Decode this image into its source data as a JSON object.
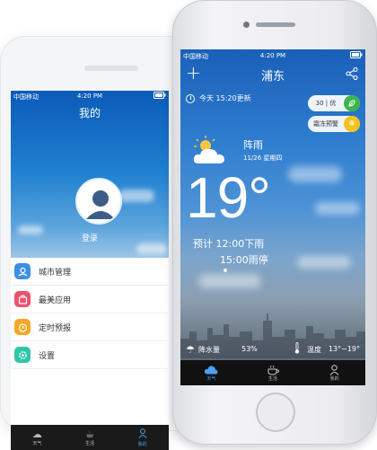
{
  "back_phone": {
    "status": {
      "carrier": "中国移动",
      "time": "4:20 PM"
    },
    "title": "我的",
    "login_label": "登录",
    "menu": [
      {
        "label": "城市管理",
        "icon": "city-icon",
        "color": "#3b8fe5"
      },
      {
        "label": "最美应用",
        "icon": "gift-icon",
        "color": "#f0506e"
      },
      {
        "label": "定时预报",
        "icon": "alarm-icon",
        "color": "#f5a623"
      },
      {
        "label": "设置",
        "icon": "gear-icon",
        "color": "#2fc7a7"
      }
    ],
    "tabs": [
      {
        "label": "天气",
        "icon": "cloud-icon"
      },
      {
        "label": "生活",
        "icon": "coffee-icon"
      },
      {
        "label": "我的",
        "icon": "person-icon"
      }
    ],
    "active_tab": "我的"
  },
  "front_phone": {
    "status": {
      "carrier": "中国移动",
      "time": "4:20 PM"
    },
    "city": "浦东",
    "update_time": "今天 15:20更新",
    "aqi": {
      "text": "30 | 优",
      "color": "#39b54a"
    },
    "warning": {
      "text": "霜冻预警",
      "color": "#f4c21f"
    },
    "condition": "阵雨",
    "date": "11/26 星期四",
    "temperature": "19°",
    "forecast_line1": "预计 12:00下雨",
    "forecast_line2": "15:00雨停",
    "precipitation": {
      "label": "降水量",
      "value": "53%"
    },
    "temp_range": {
      "label": "温度",
      "value": "13°~19°"
    },
    "tabs": [
      {
        "label": "天气",
        "icon": "cloud-icon"
      },
      {
        "label": "生活",
        "icon": "coffee-icon"
      },
      {
        "label": "我的",
        "icon": "person-icon"
      }
    ],
    "active_tab": "天气"
  }
}
